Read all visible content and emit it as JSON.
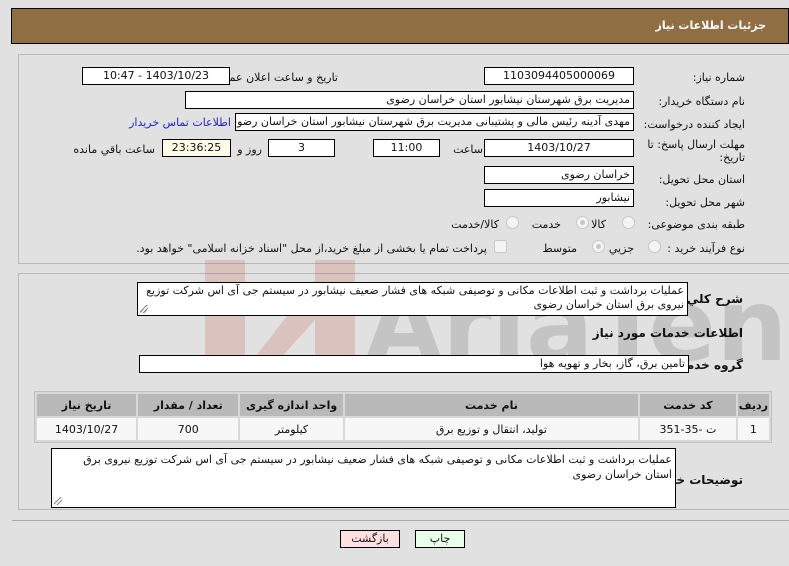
{
  "header": {
    "title": "جزئیات اطلاعات نیاز"
  },
  "form": {
    "need_number": {
      "label": "شماره نیاز:",
      "value": "1103094405000069"
    },
    "announce": {
      "label": "تاریخ و ساعت اعلان عمومي:",
      "value": "1403/10/23 - 10:47"
    },
    "buyer_org": {
      "label": "نام دستگاه خریدار:",
      "value": "مدیریت برق شهرستان نیشابور استان خراسان رضوی"
    },
    "requester": {
      "label": "ایجاد کننده درخواست:",
      "value": "مهدی آدینه رئیس مالی و پشتیبانی مدیریت برق شهرستان نیشابور استان خراسان رضوی",
      "contact_link": "اطلاعات تماس خریدار"
    },
    "deadline": {
      "label_line1": "مهلت ارسال پاسخ: تا",
      "label_line2": "تاریخ:",
      "date": "1403/10/27",
      "time_label": "ساعت",
      "time": "11:00",
      "days": "3",
      "days_label": "روز و",
      "remaining": "23:36:25",
      "remaining_label": "ساعت باقي مانده"
    },
    "province": {
      "label": "استان محل تحویل:",
      "value": "خراسان رضوی"
    },
    "city": {
      "label": "شهر محل تحویل:",
      "value": "نیشابور"
    },
    "category": {
      "label": "طبقه بندی موضوعی:",
      "options": [
        {
          "label": "کالا",
          "checked": false
        },
        {
          "label": "خدمت",
          "checked": true
        },
        {
          "label": "کالا/خدمت",
          "checked": false
        }
      ]
    },
    "process": {
      "label": "نوع فرآیند خرید :",
      "options": [
        {
          "label": "جزیي",
          "checked": false
        },
        {
          "label": "متوسط",
          "checked": true
        }
      ],
      "treasury_checkbox": "پرداخت تمام یا بخشی از مبلغ خرید،از محل \"اسناد خزانه اسلامی\" خواهد بود."
    }
  },
  "details": {
    "summary_label": "شرح کلي نیاز:",
    "summary": "عملیات برداشت و ثبت اطلاعات مکانی و توصیفی شبکه های فشار ضعیف نیشابور در سیستم جی آی اس شرکت توزیع نیروی برق استان خراسان رضوی",
    "services_heading": "اطلاعات خدمات مورد نیاز",
    "service_group_label": "گروه خدمت:",
    "service_group": "تامین برق، گاز، بخار و تهویه هوا",
    "table": {
      "headers": [
        "ردیف",
        "کد خدمت",
        "نام خدمت",
        "واحد اندازه گیری",
        "تعداد / مقدار",
        "تاریخ نیاز"
      ],
      "rows": [
        [
          "1",
          "ت -35-351",
          "تولید، انتقال و توزیع برق",
          "کیلومتر",
          "700",
          "1403/10/27"
        ]
      ]
    },
    "buyer_notes_label": "توضیحات خریدار:",
    "buyer_notes": "عملیات برداشت و ثبت اطلاعات مکانی و توصیفی شبکه های فشار ضعیف نیشابور در سیستم جی آی اس شرکت توزیع نیروی برق استان خراسان رضوی"
  },
  "buttons": {
    "print": "چاپ",
    "back": "بازگشت"
  },
  "watermark": {
    "text": "AriaTender.neT"
  }
}
